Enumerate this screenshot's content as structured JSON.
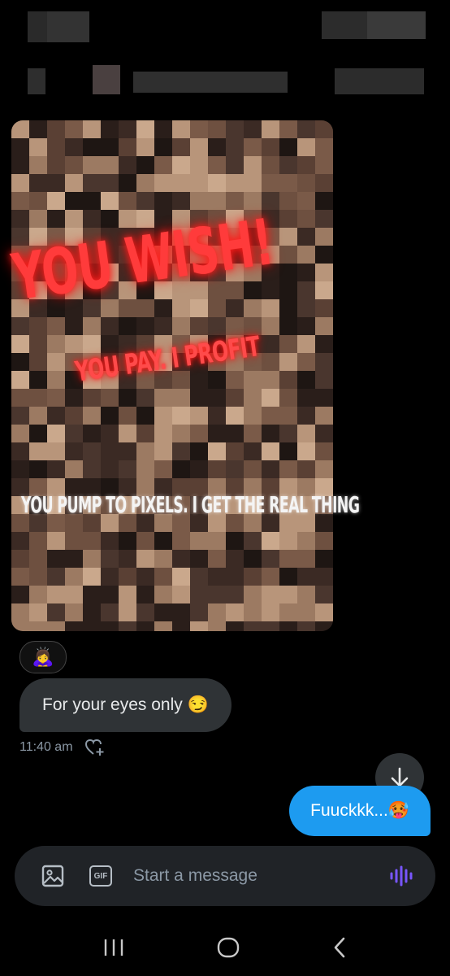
{
  "conversation": {
    "media_overlay": {
      "headline": "YOU WISH!",
      "subline": "YOU PAY. I PROFIT",
      "caption": "YOU PUMP TO PIXELS. I GET THE REAL THING"
    },
    "reaction_emoji": "🙇‍♀️",
    "received_message": {
      "text": "For your eyes only 😏",
      "timestamp": "11:40 am"
    },
    "sent_message": {
      "text": "Fuuckkk...🥵"
    }
  },
  "composer": {
    "placeholder": "Start a message",
    "gif_label": "GIF"
  },
  "colors": {
    "background": "#000000",
    "received_bubble": "#2f3336",
    "sent_bubble": "#1d9bf0",
    "accent_voice": "#7856ff",
    "neon_red": "#ff3b3b"
  },
  "icons": [
    "image-icon",
    "gif-icon",
    "voice-icon",
    "arrow-down-icon",
    "heart-plus-icon",
    "recents-icon",
    "home-icon",
    "back-icon"
  ]
}
